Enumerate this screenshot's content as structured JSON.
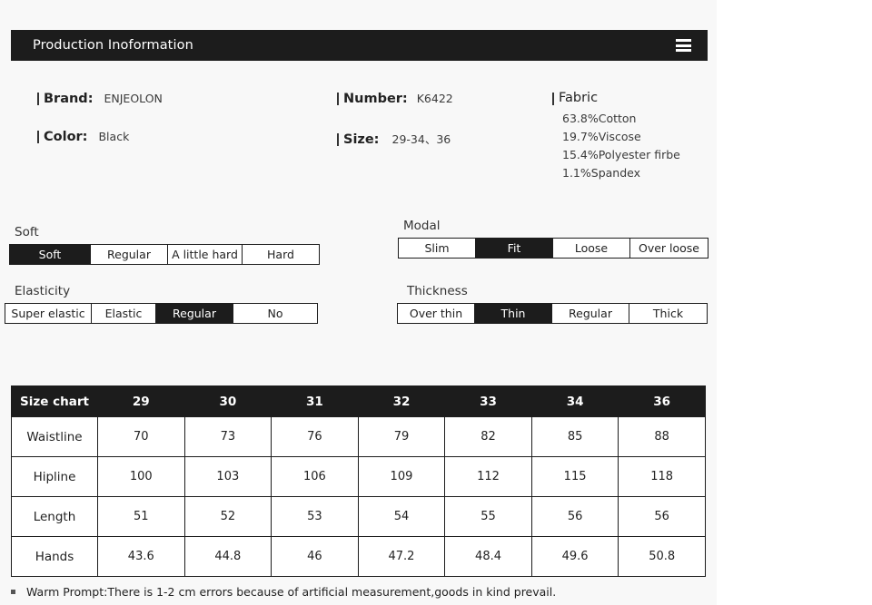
{
  "header": {
    "title": "Production Inoformation",
    "menu_icon": "hamburger-menu-icon"
  },
  "specs": {
    "brand_label": "Brand:",
    "brand_value": "ENJEOLON",
    "color_label": "Color:",
    "color_value": "Black",
    "number_label": "Number:",
    "number_value": "K6422",
    "size_label": "Size:",
    "size_value": "29-34、36",
    "fabric_label": "Fabric",
    "fabric_items": [
      "63.8%Cotton",
      "19.7%Viscose",
      "15.4%Polyester firbe",
      "1.1%Spandex"
    ]
  },
  "options": {
    "soft": {
      "label": "Soft",
      "items": [
        "Soft",
        "Regular",
        "A little hard",
        "Hard"
      ],
      "selected": "Soft"
    },
    "elasticity": {
      "label": "Elasticity",
      "items": [
        "Super elastic",
        "Elastic",
        "Regular",
        "No"
      ],
      "selected": "Regular"
    },
    "modal": {
      "label": "Modal",
      "items": [
        "Slim",
        "Fit",
        "Loose",
        "Over loose"
      ],
      "selected": "Fit"
    },
    "thickness": {
      "label": "Thickness",
      "items": [
        "Over thin",
        "Thin",
        "Regular",
        "Thick"
      ],
      "selected": "Thin"
    }
  },
  "size_chart": {
    "columns": [
      "Size chart",
      "29",
      "30",
      "31",
      "32",
      "33",
      "34",
      "36"
    ],
    "rows": [
      {
        "name": "Waistline",
        "values": [
          "70",
          "73",
          "76",
          "79",
          "82",
          "85",
          "88"
        ]
      },
      {
        "name": "Hipline",
        "values": [
          "100",
          "103",
          "106",
          "109",
          "112",
          "115",
          "118"
        ]
      },
      {
        "name": "Length",
        "values": [
          "51",
          "52",
          "53",
          "54",
          "55",
          "56",
          "56"
        ]
      },
      {
        "name": "Hands",
        "values": [
          "43.6",
          "44.8",
          "46",
          "47.2",
          "48.4",
          "49.6",
          "50.8"
        ]
      }
    ]
  },
  "footer": {
    "prompt": "Warm Prompt:There is 1-2 cm errors because of artificial measurement,goods in kind prevail."
  },
  "colors": {
    "bar_dark": "#1c1c1c",
    "panel_bg": "#f8f8f8",
    "page_bg": "#ffffff"
  }
}
